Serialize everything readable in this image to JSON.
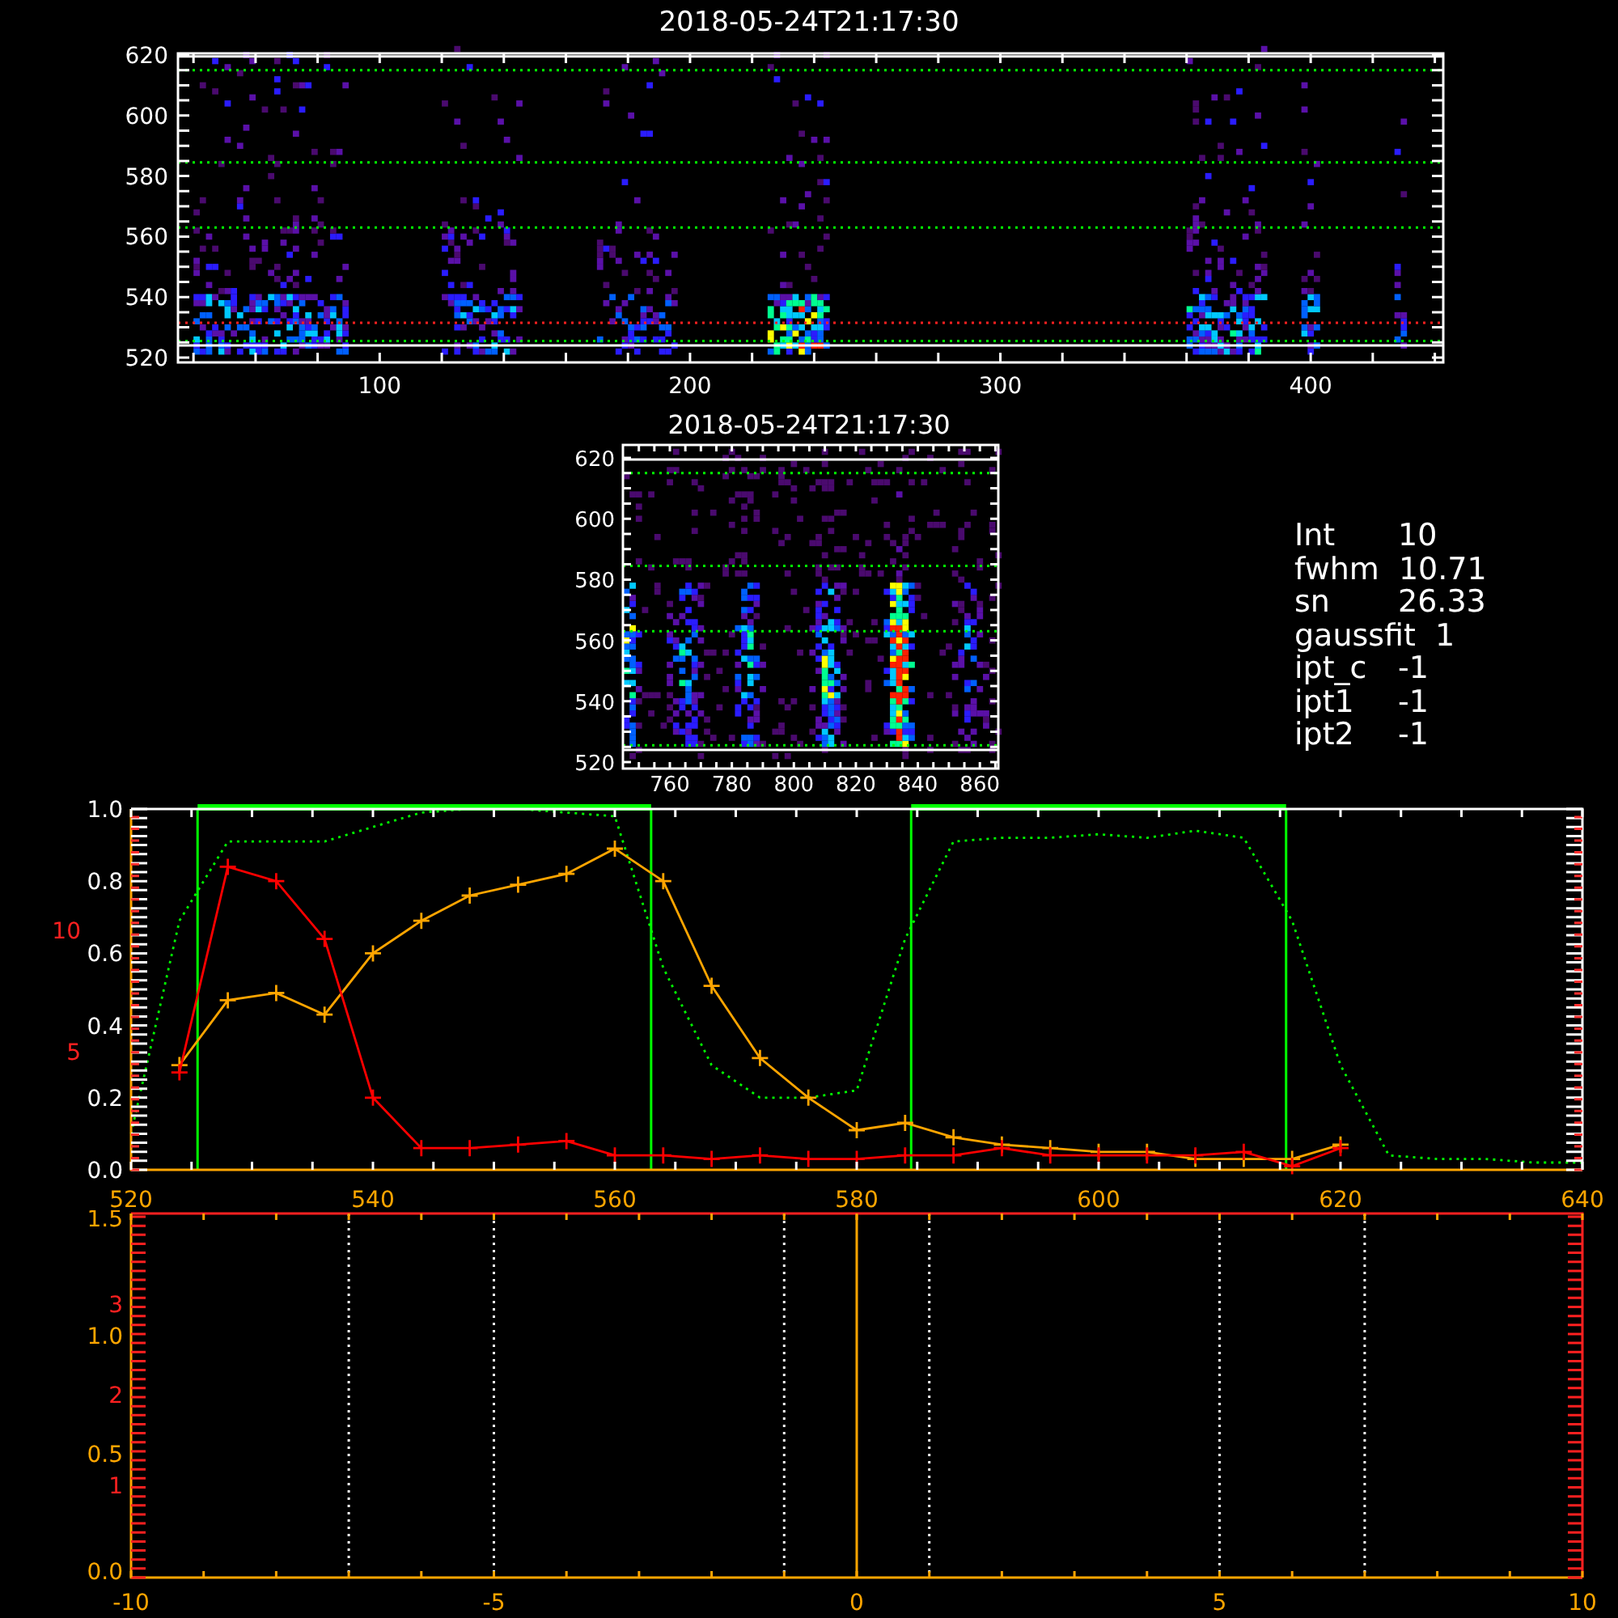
{
  "top_panel": {
    "title": "2018-05-24T21:17:30",
    "y_ticks": [
      "620",
      "600",
      "580",
      "560",
      "540",
      "520"
    ],
    "x_ticks": [
      "100",
      "200",
      "300",
      "400"
    ]
  },
  "middle_panel": {
    "title": "2018-05-24T21:17:30",
    "y_ticks": [
      "620",
      "600",
      "580",
      "560",
      "540",
      "520"
    ],
    "x_ticks": [
      "760",
      "780",
      "800",
      "820",
      "840",
      "860"
    ]
  },
  "fit_parameters": [
    {
      "label": "Int",
      "value": "10"
    },
    {
      "label": "fwhm",
      "value": "10.71"
    },
    {
      "label": "sn",
      "value": "26.33"
    },
    {
      "label": "gaussfit",
      "value": "1"
    },
    {
      "label": "ipt_c",
      "value": "-1"
    },
    {
      "label": "ipt1",
      "value": "-1"
    },
    {
      "label": "ipt2",
      "value": "-1"
    }
  ],
  "profile_panel": {
    "secondary_ticks": [
      "10",
      "5"
    ],
    "chart_data": {
      "type": "line",
      "x": [
        520,
        524,
        528,
        532,
        536,
        540,
        544,
        548,
        552,
        556,
        560,
        564,
        568,
        572,
        576,
        580,
        584,
        588,
        592,
        596,
        600,
        604,
        608,
        612,
        616,
        620,
        624,
        628,
        632,
        636,
        640
      ],
      "xlim": [
        520,
        640
      ],
      "ylim": [
        0,
        1
      ],
      "xticks": [
        520,
        540,
        560,
        580,
        600,
        620,
        640
      ],
      "yticks": [
        {
          "value": 0,
          "label": "0.0"
        },
        {
          "value": 0.2,
          "label": "0.2"
        },
        {
          "value": 0.4,
          "label": "0.4"
        },
        {
          "value": 0.6,
          "label": "0.6"
        },
        {
          "value": 0.8,
          "label": "0.8"
        },
        {
          "value": 1,
          "label": "1.0"
        }
      ],
      "series": [
        {
          "color": "#00ff00",
          "line_style": "dotted",
          "values": [
            0.1,
            0.69,
            0.91,
            0.91,
            0.91,
            0.95,
            0.99,
            1.0,
            1.0,
            0.99,
            0.98,
            0.56,
            0.29,
            0.2,
            0.2,
            0.22,
            0.64,
            0.91,
            0.92,
            0.92,
            0.93,
            0.92,
            0.94,
            0.92,
            0.69,
            0.29,
            0.04,
            0.03,
            0.03,
            0.02,
            0.02
          ]
        },
        {
          "color": "#ffa500",
          "marker": "+",
          "values": [
            null,
            0.29,
            0.47,
            0.49,
            0.43,
            0.6,
            0.69,
            0.76,
            0.79,
            0.82,
            0.89,
            0.8,
            0.51,
            0.31,
            0.2,
            0.11,
            0.13,
            0.09,
            0.07,
            0.06,
            0.05,
            0.05,
            0.03,
            0.03,
            0.03,
            0.07,
            null,
            null,
            null,
            null,
            null
          ]
        },
        {
          "color": "#ff0000",
          "marker": "+",
          "values": [
            null,
            0.27,
            0.84,
            0.8,
            0.64,
            0.2,
            0.06,
            0.06,
            0.07,
            0.08,
            0.04,
            0.04,
            0.03,
            0.04,
            0.03,
            0.03,
            0.04,
            0.04,
            0.06,
            0.04,
            0.04,
            0.04,
            0.04,
            0.05,
            0.01,
            0.06,
            null,
            null,
            null,
            null,
            null
          ]
        }
      ],
      "ref_lines": [
        {
          "axis": "x",
          "value": 525.5,
          "color": "#00ff00"
        },
        {
          "axis": "x",
          "value": 563,
          "color": "#00ff00"
        },
        {
          "axis": "x",
          "value": 584.5,
          "color": "#00ff00"
        },
        {
          "axis": "x",
          "value": 615.5,
          "color": "#00ff00"
        }
      ]
    }
  },
  "offset_panel": {
    "x_ticks": [
      "-10",
      "-5",
      "0",
      "5",
      "10"
    ],
    "y_ticks": [
      "1.5",
      "1.0",
      "0.5",
      "0.0"
    ],
    "secondary_ticks": [
      "3",
      "2",
      "1"
    ]
  }
}
